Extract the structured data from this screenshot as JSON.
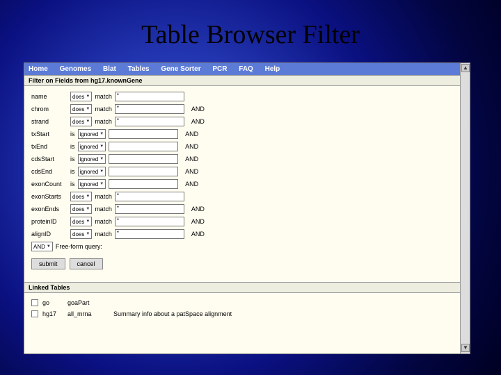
{
  "slide": {
    "title": "Table Browser Filter"
  },
  "menu": {
    "items": [
      "Home",
      "Genomes",
      "Blat",
      "Tables",
      "Gene Sorter",
      "PCR",
      "FAQ",
      "Help"
    ]
  },
  "filter": {
    "header": "Filter on Fields from hg17.knownGene",
    "does": "does",
    "match": "match",
    "is": "is",
    "ignored": "ignored",
    "and": "AND",
    "wild": "*",
    "rows": {
      "r0": "name",
      "r1": "chrom",
      "r2": "strand",
      "r3": "txStart",
      "r4": "txEnd",
      "r5": "cdsStart",
      "r6": "cdsEnd",
      "r7": "exonCount",
      "r8": "exonStarts",
      "r9": "exonEnds",
      "r10": "proteinID",
      "r11": "alignID"
    },
    "freeform_label": "Free-form query:",
    "and_dropdown": "AND",
    "submit": "submit",
    "cancel": "cancel"
  },
  "linked": {
    "header": "Linked Tables",
    "rows": [
      {
        "db": "go",
        "table": "goaPart",
        "desc": ""
      },
      {
        "db": "hg17",
        "table": "all_mrna",
        "desc": "Summary info about a patSpace alignment"
      }
    ]
  }
}
